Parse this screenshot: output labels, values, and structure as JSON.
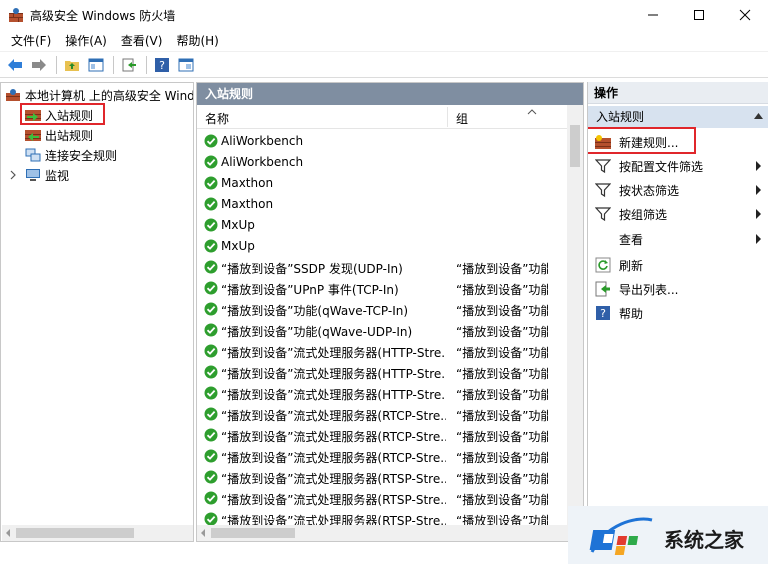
{
  "window": {
    "title": "高级安全 Windows 防火墙"
  },
  "menu": [
    "文件(F)",
    "操作(A)",
    "查看(V)",
    "帮助(H)"
  ],
  "tree": {
    "root": "本地计算机 上的高级安全 Windows",
    "nodes": [
      "入站规则",
      "出站规则",
      "连接安全规则",
      "监视"
    ]
  },
  "center": {
    "header": "入站规则",
    "columns": {
      "name": "名称",
      "group": "组"
    },
    "rows": [
      {
        "name": "AliWorkbench",
        "group": ""
      },
      {
        "name": "AliWorkbench",
        "group": ""
      },
      {
        "name": "Maxthon",
        "group": ""
      },
      {
        "name": "Maxthon",
        "group": ""
      },
      {
        "name": "MxUp",
        "group": ""
      },
      {
        "name": "MxUp",
        "group": ""
      },
      {
        "name": "“播放到设备”SSDP 发现(UDP-In)",
        "group": "“播放到设备”功能"
      },
      {
        "name": "“播放到设备”UPnP 事件(TCP-In)",
        "group": "“播放到设备”功能"
      },
      {
        "name": "“播放到设备”功能(qWave-TCP-In)",
        "group": "“播放到设备”功能"
      },
      {
        "name": "“播放到设备”功能(qWave-UDP-In)",
        "group": "“播放到设备”功能"
      },
      {
        "name": "“播放到设备”流式处理服务器(HTTP-Stre...",
        "group": "“播放到设备”功能"
      },
      {
        "name": "“播放到设备”流式处理服务器(HTTP-Stre...",
        "group": "“播放到设备”功能"
      },
      {
        "name": "“播放到设备”流式处理服务器(HTTP-Stre...",
        "group": "“播放到设备”功能"
      },
      {
        "name": "“播放到设备”流式处理服务器(RTCP-Stre...",
        "group": "“播放到设备”功能"
      },
      {
        "name": "“播放到设备”流式处理服务器(RTCP-Stre...",
        "group": "“播放到设备”功能"
      },
      {
        "name": "“播放到设备”流式处理服务器(RTCP-Stre...",
        "group": "“播放到设备”功能"
      },
      {
        "name": "“播放到设备”流式处理服务器(RTSP-Stre...",
        "group": "“播放到设备”功能"
      },
      {
        "name": "“播放到设备”流式处理服务器(RTSP-Stre...",
        "group": "“播放到设备”功能"
      },
      {
        "name": "“播放到设备”流式处理服务器(RTSP-Stre...",
        "group": "“播放到设备”功能"
      }
    ]
  },
  "actions": {
    "header": "操作",
    "section": "入站规则",
    "items": [
      "新建规则...",
      "按配置文件筛选",
      "按状态筛选",
      "按组筛选",
      "查看",
      "刷新",
      "导出列表...",
      "帮助"
    ]
  },
  "watermark": {
    "text": "系统之家"
  },
  "colors": {
    "center_header_bg": "#7f8ea1",
    "section_bg": "#d7e2ef",
    "highlight_red": "#e0262b",
    "check_green": "#2e9e2e"
  }
}
